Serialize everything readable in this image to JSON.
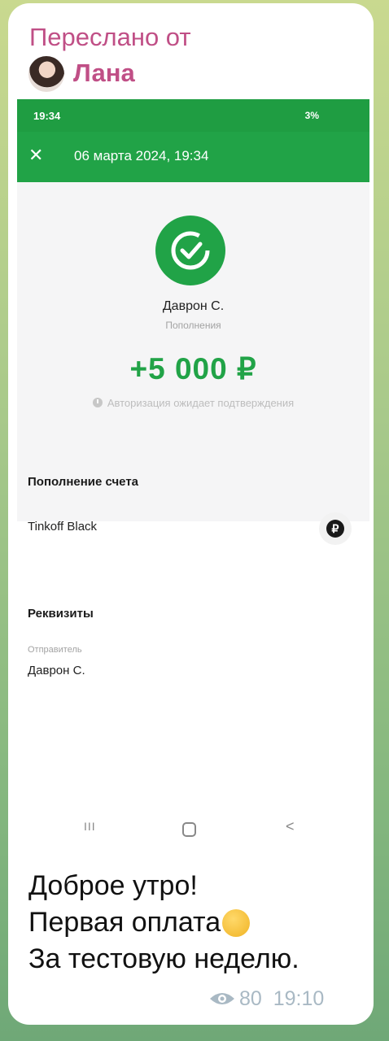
{
  "forward": {
    "label": "Переслано от",
    "name": "Лана"
  },
  "screenshot": {
    "status_bar": {
      "time": "19:34",
      "battery": "3%"
    },
    "header": {
      "date": "06 марта 2024, 19:34"
    },
    "operation": {
      "payee": "Даврон С.",
      "category": "Пополнения",
      "amount": "+5 000 ₽",
      "status": "Авторизация ожидает подтверждения"
    },
    "details": {
      "section_title": "Пополнение счета",
      "account": "Tinkoff Black",
      "account_badge": "₽"
    },
    "requisites": {
      "section_title": "Реквизиты",
      "sender_label": "Отправитель",
      "sender": "Даврон С."
    },
    "nav": {
      "recent": "III",
      "back": "<"
    }
  },
  "message": {
    "line1": "Доброе утро!",
    "line2": "Первая оплата",
    "line3": "За тестовую неделю."
  },
  "meta": {
    "views": "80",
    "time": "19:10"
  },
  "colors": {
    "accent_green": "#21a347",
    "forward_pink": "#c04f86"
  }
}
